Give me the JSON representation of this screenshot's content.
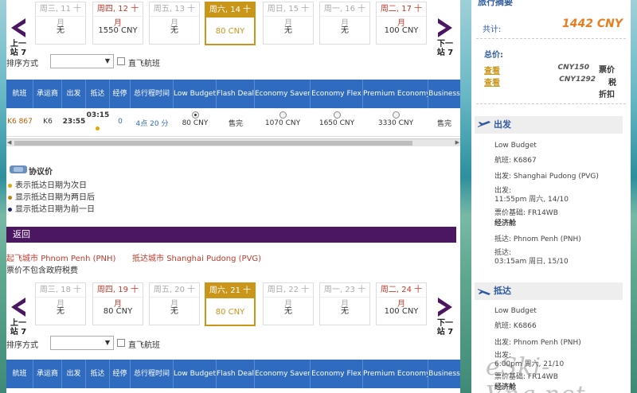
{
  "outbound": {
    "prev_label": "上一站 7",
    "next_label": "下一站 7",
    "dates": [
      {
        "day": "周三, 11 十月",
        "price": "无",
        "weekend": false,
        "selected": false
      },
      {
        "day": "周四, 12 十月",
        "price": "1550 CNY",
        "weekend": true,
        "selected": false
      },
      {
        "day": "周五, 13 十月",
        "price": "无",
        "weekend": false,
        "selected": false
      },
      {
        "day": "周六, 14 十月",
        "price": "80 CNY",
        "weekend": false,
        "selected": true
      },
      {
        "day": "周日, 15 十月",
        "price": "无",
        "weekend": false,
        "selected": false
      },
      {
        "day": "周一, 16 十月",
        "price": "无",
        "weekend": false,
        "selected": false
      },
      {
        "day": "周二, 17 十月",
        "price": "100 CNY",
        "weekend": true,
        "selected": false
      }
    ],
    "sort_label": "排序方式",
    "direct_label": "直飞航班",
    "headers": [
      "航班",
      "承运商",
      "出发",
      "抵达",
      "经停",
      "总行程时间",
      "Low Budget",
      "Flash Deal",
      "Economy Saver",
      "Economy Flex",
      "Premium Economy",
      "Business"
    ],
    "row": {
      "flight": "K6 867",
      "carrier": "K6",
      "depart": "23:55",
      "arrive": "03:15",
      "stops": "0",
      "duration": "4点 20 分",
      "low_budget": "80 CNY",
      "flash_deal": "售完",
      "economy_saver": "1070 CNY",
      "economy_flex": "1650 CNY",
      "premium_economy": "3330 CNY",
      "business": "售完"
    }
  },
  "legend": {
    "title": "协议价",
    "items": [
      {
        "text": "表示抵达日期为次日",
        "color": "#e0a800"
      },
      {
        "text": "显示抵达日期为两日后",
        "color": "#b8860b"
      },
      {
        "text": "显示抵达日期为前一日",
        "color": "#1a237e"
      }
    ]
  },
  "return": {
    "bar_label": "返回",
    "origin_label": "起飞城市",
    "origin": "Phnom Penh (PNH)",
    "dest_label": "抵达城市",
    "dest": "Shanghai Pudong (PVG)",
    "tax_note": "票价不包含政府税费",
    "prev_label": "上一站 7",
    "next_label": "下一站 7",
    "dates": [
      {
        "day": "周三, 18 十月",
        "price": "无",
        "weekend": false,
        "selected": false
      },
      {
        "day": "周四, 19 十月",
        "price": "80 CNY",
        "weekend": true,
        "selected": false
      },
      {
        "day": "周五, 20 十月",
        "price": "无",
        "weekend": false,
        "selected": false
      },
      {
        "day": "周六, 21 十月",
        "price": "80 CNY",
        "weekend": false,
        "selected": true
      },
      {
        "day": "周日, 22 十月",
        "price": "无",
        "weekend": false,
        "selected": false
      },
      {
        "day": "周一, 23 十月",
        "price": "无",
        "weekend": false,
        "selected": false
      },
      {
        "day": "周二, 24 十月",
        "price": "100 CNY",
        "weekend": true,
        "selected": false
      }
    ],
    "sort_label": "排序方式",
    "direct_label": "直飞航班",
    "headers": [
      "航班",
      "承运商",
      "出发",
      "抵达",
      "经停",
      "总行程时间",
      "Low Budget",
      "Flash Deal",
      "Economy Saver",
      "Economy Flex",
      "Premium Economy",
      "Business"
    ]
  },
  "side": {
    "title": "旅行摘要",
    "total_label": "共计:",
    "total_value": "1442 CNY",
    "price_label": "总价:",
    "view1": "查看",
    "view1_price": "CNY150",
    "view1_desc": "票价",
    "view2": "查看",
    "view2_price": "CNY1292",
    "view2_desc1": "税",
    "view2_desc2": "折扣",
    "depart": {
      "head": "出发",
      "fare_class": "Low Budget",
      "flight_label": "航班:",
      "flight": "K6867",
      "from_label": "出发:",
      "from": "Shanghai Pudong (PVG)",
      "time_label": "出发:",
      "time": "11:55pm 周六, 14/10",
      "basis_label": "票价基础:",
      "basis": "FR14WB",
      "cabin": "经济舱",
      "to_label": "抵达:",
      "to": "Phnom Penh (PNH)",
      "arr_label": "抵达:",
      "arr_time": "03:15am 周日, 15/10"
    },
    "arrive": {
      "head": "抵达",
      "fare_class": "Low Budget",
      "flight_label": "航班:",
      "flight": "K6866",
      "from_label": "出发:",
      "from": "Phnom Penh (PNH)",
      "time_label": "出发:",
      "time": "6:00pm 周六, 21/10",
      "basis_label": "票价基础:",
      "basis": "FR14WB",
      "cabin": "经济舱"
    }
  },
  "watermark": "eSki-Vng.net",
  "colors": {
    "header_blue": "#2f6bbf",
    "selected_gold": "#c9961a",
    "return_purple": "#4b1763",
    "weekend_red": "#c0392b",
    "total_orange": "#e67e22"
  }
}
